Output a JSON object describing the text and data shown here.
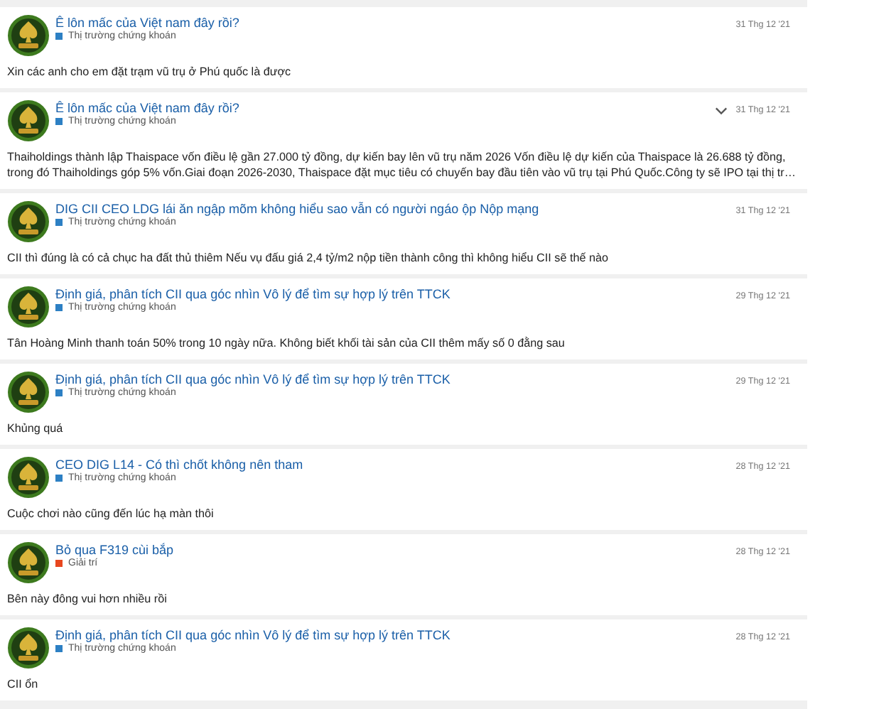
{
  "posts": [
    {
      "title": "Ê lôn mấc của Việt nam đây rồi?",
      "category": "Thị trường chứng khoán",
      "color": "#2d80c4",
      "date": "31 Thg 12 '21",
      "menu": false,
      "body": "Xin các anh cho em đặt trạm vũ trụ ở Phú quốc là được"
    },
    {
      "title": "Ê lôn mấc của Việt nam đây rồi?",
      "category": "Thị trường chứng khoán",
      "color": "#2d80c4",
      "date": "31 Thg 12 '21",
      "menu": true,
      "body": "Thaiholdings thành lập Thaispace vốn điều lệ gần 27.000 tỷ đồng, dự kiến bay lên vũ trụ năm 2026 Vốn điều lệ dự kiến của Thaispace là 26.688 tỷ đồng, trong đó Thaiholdings góp 5% vốn.Giai đoạn 2026-2030, Thaispace đặt mục tiêu có chuyến bay đầu tiên vào vũ trụ tại Phú Quốc.Công ty sẽ IPO tại thị tr…"
    },
    {
      "title": "DIG CII CEO LDG lái ăn ngập mõm không hiểu sao vẫn có người ngáo ộp Nộp mạng",
      "category": "Thị trường chứng khoán",
      "color": "#2d80c4",
      "date": "31 Thg 12 '21",
      "menu": false,
      "body": "CII thì đúng là có cả chục ha đất thủ thiêm Nếu vụ đấu giá 2,4 tỷ/m2 nộp tiền thành công thì không hiểu CII sẽ thế nào"
    },
    {
      "title": "Định giá, phân tích CII qua góc nhìn Vô lý để tìm sự hợp lý trên TTCK",
      "category": "Thị trường chứng khoán",
      "color": "#2d80c4",
      "date": "29 Thg 12 '21",
      "menu": false,
      "body": "Tân Hoàng Minh thanh toán 50% trong 10 ngày nữa. Không biết khối tài sản của CII thêm mấy số 0 đằng sau"
    },
    {
      "title": "Định giá, phân tích CII qua góc nhìn Vô lý để tìm sự hợp lý trên TTCK",
      "category": "Thị trường chứng khoán",
      "color": "#2d80c4",
      "date": "29 Thg 12 '21",
      "menu": false,
      "body": "Khủng quá"
    },
    {
      "title": "CEO DIG L14 - Có thì chốt không nên tham",
      "category": "Thị trường chứng khoán",
      "color": "#2d80c4",
      "date": "28 Thg 12 '21",
      "menu": false,
      "body": "Cuộc chơi nào cũng đến lúc hạ màn thôi"
    },
    {
      "title": "Bỏ qua F319 cùi bắp",
      "category": "Giải trí",
      "color": "#e8471f",
      "date": "28 Thg 12 '21",
      "menu": false,
      "body": "Bên này đông vui hơn nhiều rồi"
    },
    {
      "title": "Định giá, phân tích CII qua góc nhìn Vô lý để tìm sự hợp lý trên TTCK",
      "category": "Thị trường chứng khoán",
      "color": "#2d80c4",
      "date": "28 Thg 12 '21",
      "menu": false,
      "body": "CII ổn"
    }
  ]
}
